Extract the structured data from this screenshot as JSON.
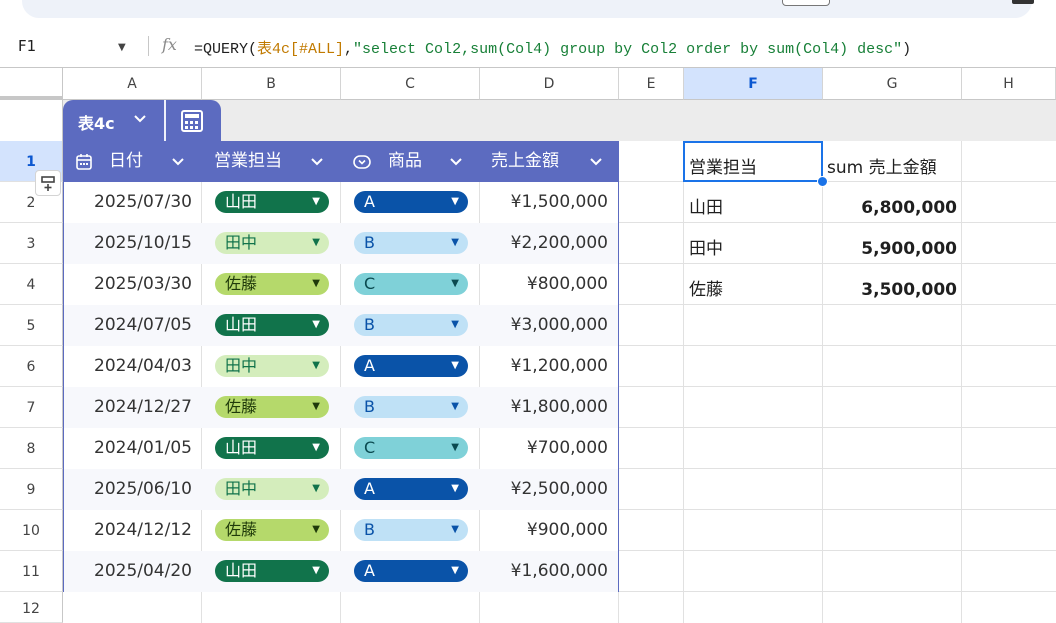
{
  "formula_bar": {
    "cell_ref": "F1",
    "fx_label": "fx",
    "formula_prefix": "=QUERY(",
    "formula_ref": "表4c[#ALL]",
    "formula_comma": ",",
    "formula_string": "\"select Col2,sum(Col4) group by Col2 order by sum(Col4) desc\"",
    "formula_suffix": ")"
  },
  "columns": [
    "A",
    "B",
    "C",
    "D",
    "E",
    "F",
    "G",
    "H"
  ],
  "rows": [
    "1",
    "2",
    "3",
    "4",
    "5",
    "6",
    "7",
    "8",
    "9",
    "10",
    "11",
    "12"
  ],
  "selected_column": "F",
  "selected_row": "1",
  "table": {
    "name": "表4c",
    "headers": {
      "date": "日付",
      "sales_rep": "営業担当",
      "product": "商品",
      "amount": "売上金額"
    },
    "rows": [
      {
        "date": "2025/07/30",
        "rep": "山田",
        "product": "A",
        "amount": "¥1,500,000"
      },
      {
        "date": "2025/10/15",
        "rep": "田中",
        "product": "B",
        "amount": "¥2,200,000"
      },
      {
        "date": "2025/03/30",
        "rep": "佐藤",
        "product": "C",
        "amount": "¥800,000"
      },
      {
        "date": "2024/07/05",
        "rep": "山田",
        "product": "B",
        "amount": "¥3,000,000"
      },
      {
        "date": "2024/04/03",
        "rep": "田中",
        "product": "A",
        "amount": "¥1,200,000"
      },
      {
        "date": "2024/12/27",
        "rep": "佐藤",
        "product": "B",
        "amount": "¥1,800,000"
      },
      {
        "date": "2024/01/05",
        "rep": "山田",
        "product": "C",
        "amount": "¥700,000"
      },
      {
        "date": "2025/06/10",
        "rep": "田中",
        "product": "A",
        "amount": "¥2,500,000"
      },
      {
        "date": "2024/12/12",
        "rep": "佐藤",
        "product": "B",
        "amount": "¥900,000"
      },
      {
        "date": "2025/04/20",
        "rep": "山田",
        "product": "A",
        "amount": "¥1,600,000"
      }
    ]
  },
  "chip_colors": {
    "山田": {
      "bg": "#11734b",
      "fg": "#ffffff"
    },
    "田中": {
      "bg": "#d4edbc",
      "fg": "#11734b"
    },
    "佐藤": {
      "bg": "#b5d96b",
      "fg": "#1f3a0a"
    },
    "A": {
      "bg": "#0a53a8",
      "fg": "#ffffff"
    },
    "B": {
      "bg": "#bfe1f6",
      "fg": "#0a53a8"
    },
    "C": {
      "bg": "#7fd1d8",
      "fg": "#0a4a50"
    }
  },
  "query_result": {
    "header_rep": "営業担当",
    "header_sum": "sum 売上金額",
    "rows": [
      {
        "rep": "山田",
        "sum": "6,800,000"
      },
      {
        "rep": "田中",
        "sum": "5,900,000"
      },
      {
        "rep": "佐藤",
        "sum": "3,500,000"
      }
    ]
  },
  "colors": {
    "table_header": "#5c6bc0",
    "selection": "#1a73e8",
    "selected_header_bg": "#d3e3fd"
  }
}
